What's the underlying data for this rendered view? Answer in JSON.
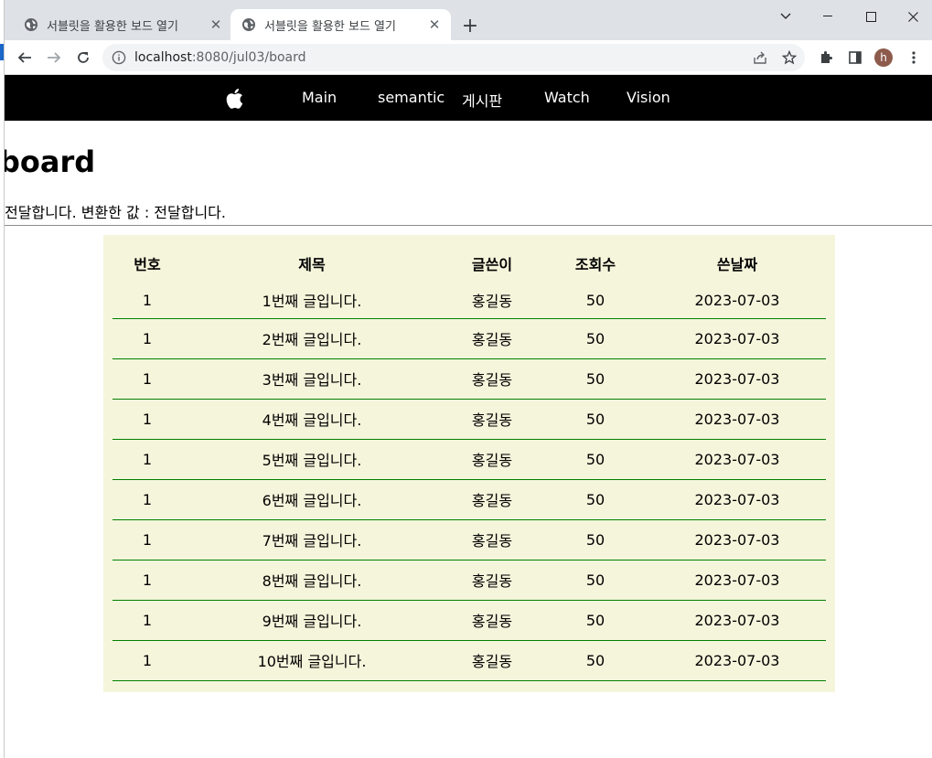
{
  "browser": {
    "tabs": [
      {
        "title": "서블릿을 활용한 보드 열기",
        "active": false
      },
      {
        "title": "서블릿을 활용한 보드 열기",
        "active": true
      }
    ],
    "url_host": "localhost",
    "url_rest": ":8080/jul03/board",
    "avatar_letter": "h"
  },
  "nav": {
    "logo_icon": "apple-icon",
    "items": [
      "Main",
      "semantic",
      "게시판",
      "Watch",
      "Vision"
    ]
  },
  "page": {
    "title": "board",
    "message": "전달합니다. 변환한 값 : 전달합니다."
  },
  "board": {
    "headers": [
      "번호",
      "제목",
      "글쓴이",
      "조회수",
      "쓴날짜"
    ],
    "rows": [
      [
        "1",
        "1번째 글입니다.",
        "홍길동",
        "50",
        "2023-07-03"
      ],
      [
        "1",
        "2번째 글입니다.",
        "홍길동",
        "50",
        "2023-07-03"
      ],
      [
        "1",
        "3번째 글입니다.",
        "홍길동",
        "50",
        "2023-07-03"
      ],
      [
        "1",
        "4번째 글입니다.",
        "홍길동",
        "50",
        "2023-07-03"
      ],
      [
        "1",
        "5번째 글입니다.",
        "홍길동",
        "50",
        "2023-07-03"
      ],
      [
        "1",
        "6번째 글입니다.",
        "홍길동",
        "50",
        "2023-07-03"
      ],
      [
        "1",
        "7번째 글입니다.",
        "홍길동",
        "50",
        "2023-07-03"
      ],
      [
        "1",
        "8번째 글입니다.",
        "홍길동",
        "50",
        "2023-07-03"
      ],
      [
        "1",
        "9번째 글입니다.",
        "홍길동",
        "50",
        "2023-07-03"
      ],
      [
        "1",
        "10번째 글입니다.",
        "홍길동",
        "50",
        "2023-07-03"
      ]
    ]
  },
  "colors": {
    "navbar_bg": "#000000",
    "board_bg": "#f5f5dc",
    "row_border": "#008000"
  }
}
